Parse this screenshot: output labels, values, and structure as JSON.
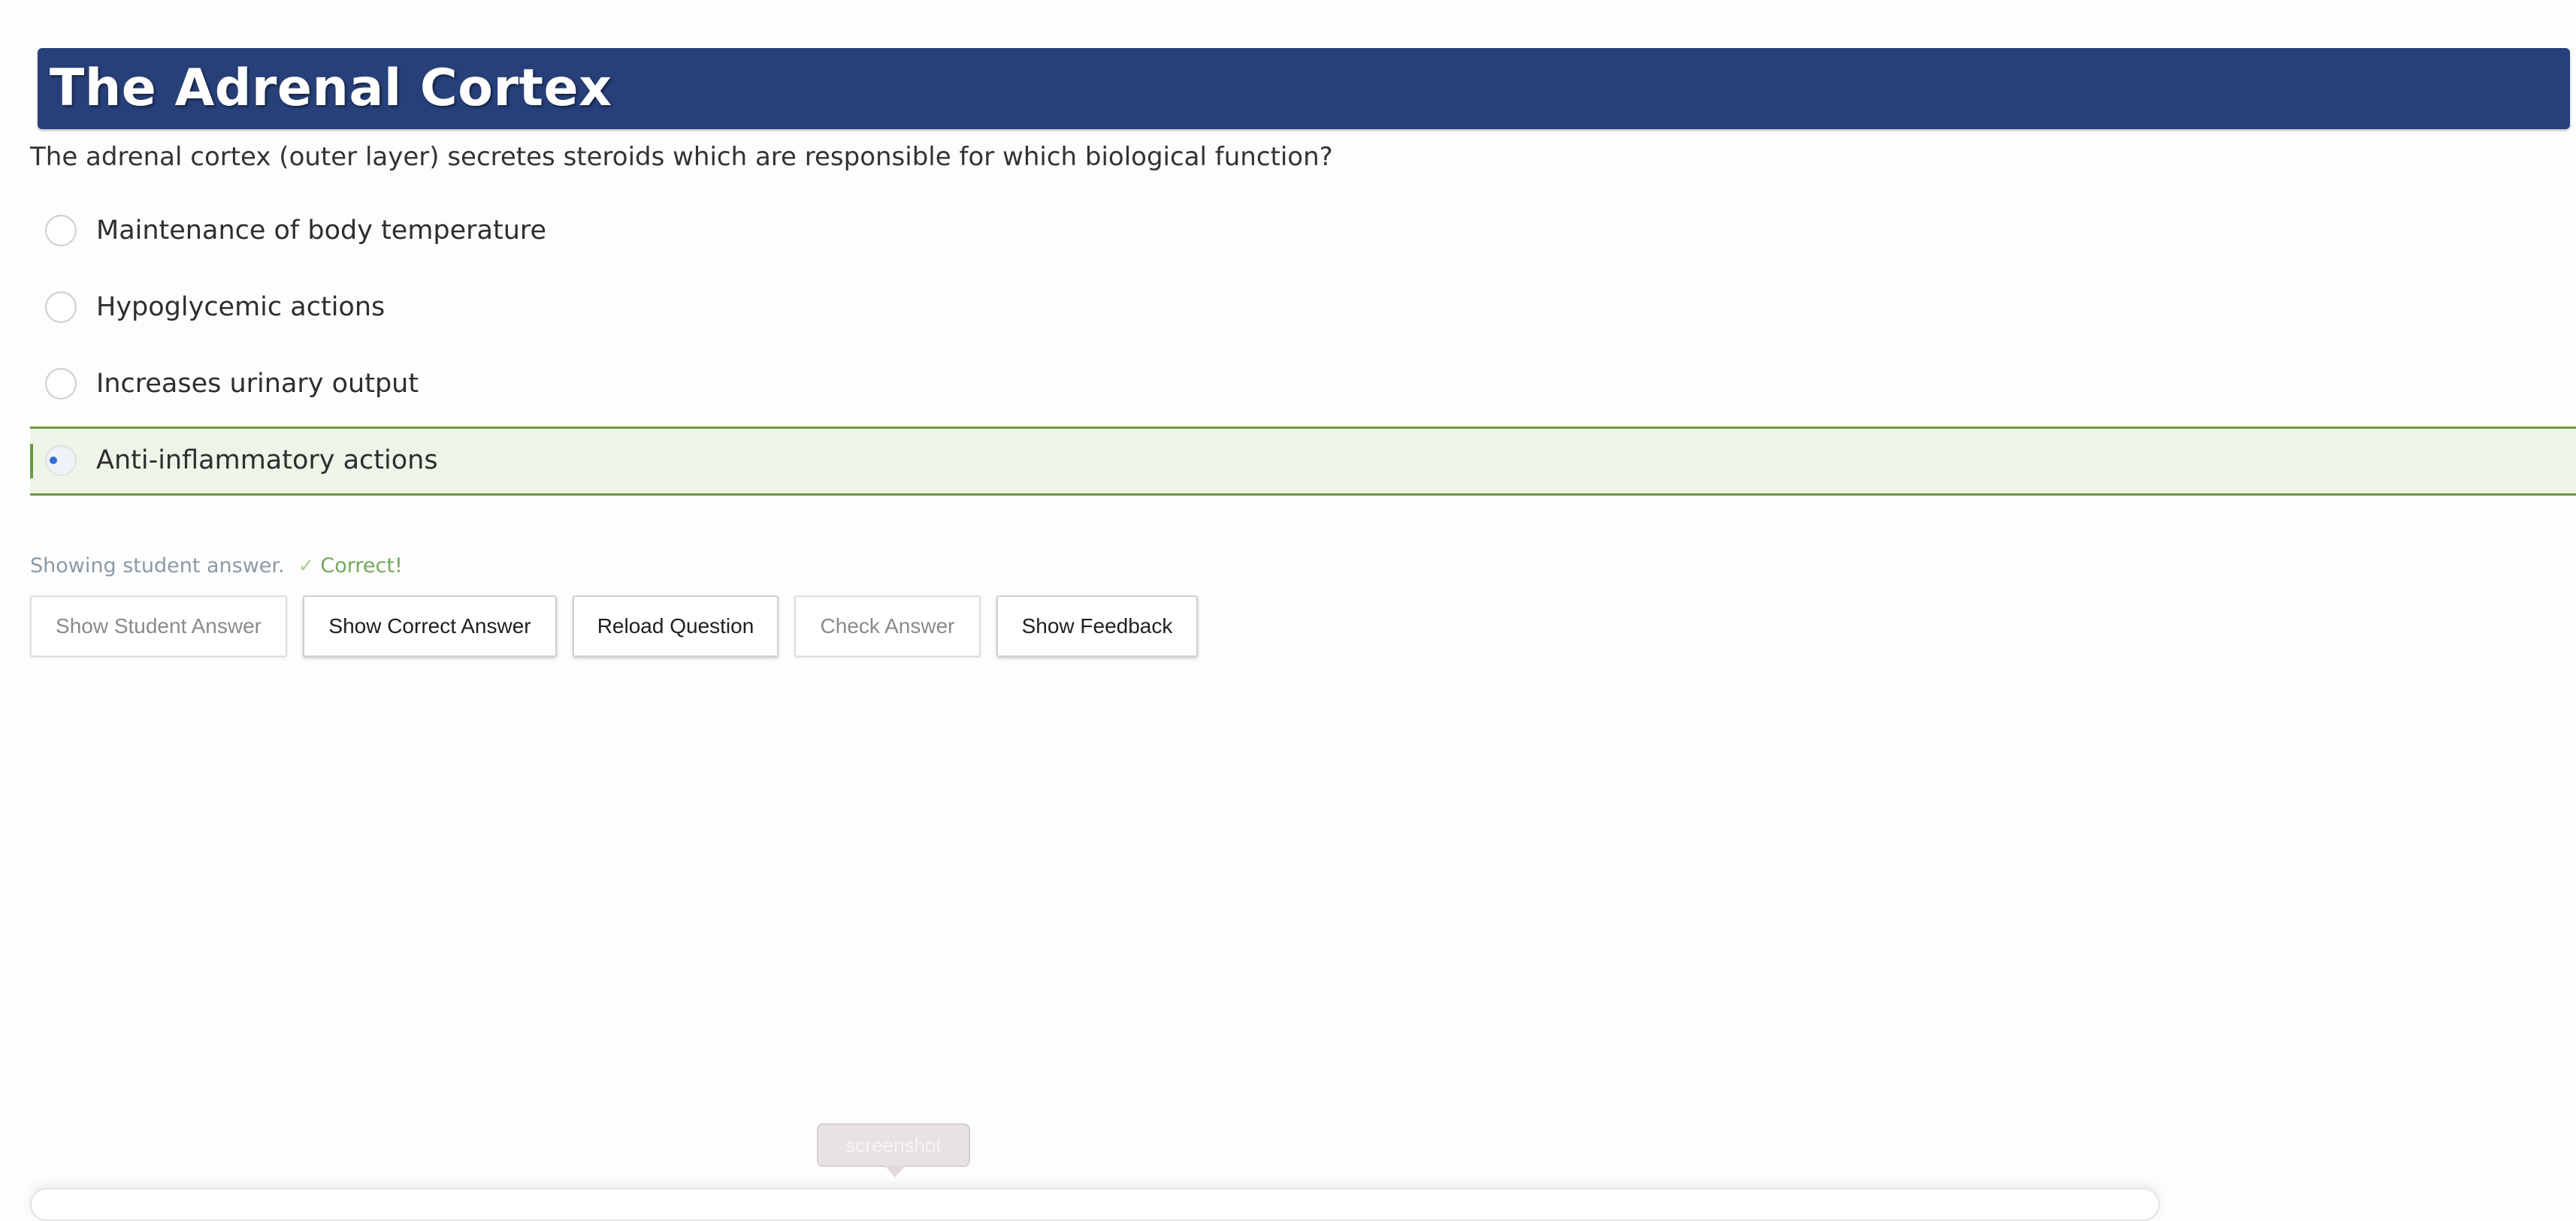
{
  "header": {
    "title": "The Adrenal Cortex"
  },
  "question": {
    "text": "The adrenal cortex (outer layer) secretes steroids which are responsible for which biological function?"
  },
  "options": [
    {
      "label": "Maintenance of body temperature",
      "selected": false
    },
    {
      "label": "Hypoglycemic actions",
      "selected": false
    },
    {
      "label": "Increases urinary output",
      "selected": false
    },
    {
      "label": "Anti-inflammatory actions",
      "selected": true
    }
  ],
  "status": {
    "text": "Showing student answer.",
    "icon": "check-icon",
    "result": "Correct!"
  },
  "buttons": {
    "show_student_answer": "Show Student Answer",
    "show_correct_answer": "Show Correct Answer",
    "reload_question": "Reload Question",
    "check_answer": "Check Answer",
    "show_feedback": "Show Feedback"
  },
  "tooltip": {
    "text": "screenshot"
  },
  "colors": {
    "title_bar": "#274079",
    "selected_background": "#eef4e8",
    "selected_border": "#6c9a41",
    "correct_text": "#74a85a",
    "radio_dot": "#2f6fd6"
  }
}
